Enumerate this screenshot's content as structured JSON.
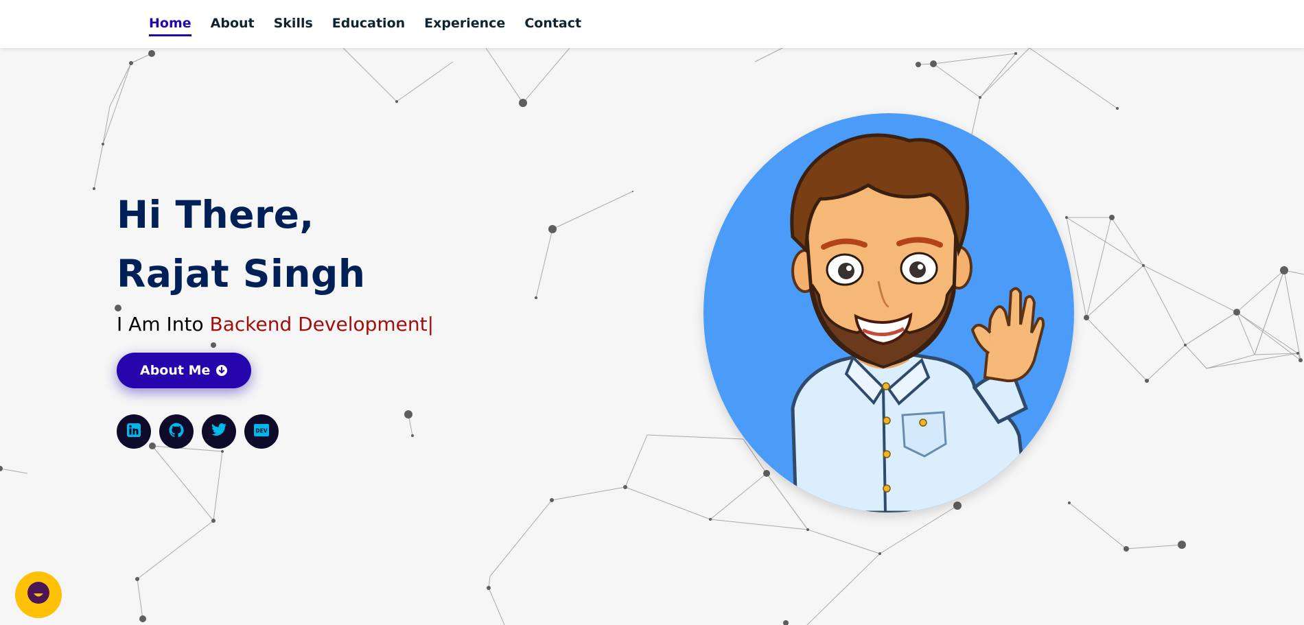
{
  "nav": {
    "links": [
      "Home",
      "About",
      "Skills",
      "Education",
      "Experience",
      "Contact"
    ],
    "active": "Home"
  },
  "hero": {
    "greeting": "Hi There,",
    "name": "Rajat Singh",
    "typed_prefix": "I Am Into",
    "typed_text": "Backend Development",
    "cursor": "|",
    "about_button_label": "About Me"
  },
  "socials": [
    {
      "icon": "linkedin-icon"
    },
    {
      "icon": "github-icon"
    },
    {
      "icon": "twitter-icon"
    },
    {
      "icon": "dev-icon",
      "text": "DEV"
    }
  ],
  "avatar": {
    "icon": "bitmoji-avatar-waving"
  },
  "chat": {
    "icon": "chat-widget-icon"
  },
  "colors": {
    "navy": "#002057",
    "accent": "#2506ad",
    "typed": "#a00e0e",
    "avatar_bg": "#4a9cf8",
    "chat_bg": "#ffc107",
    "social_icon": "#00b7e8"
  }
}
